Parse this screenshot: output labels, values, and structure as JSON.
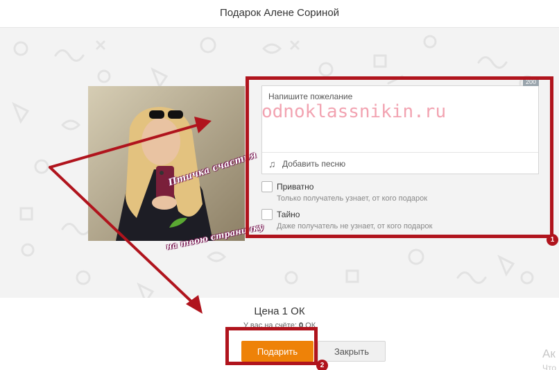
{
  "dialog": {
    "title": "Подарок Алене Сориной"
  },
  "wish": {
    "placeholder": "Напишите пожелание",
    "counter": "200",
    "add_song_label": "Добавить песню"
  },
  "watermark": "odnoklassnikin.ru",
  "sticker": {
    "line1": "Птичка счастья",
    "line2": "на твою страничку"
  },
  "options": [
    {
      "label": "Приватно",
      "hint": "Только получатель узнает, от кого подарок"
    },
    {
      "label": "Тайно",
      "hint": "Даже получатель не узнает, от кого подарок"
    }
  ],
  "price": {
    "label": "Цена 1 ОК",
    "balance_prefix": "У вас на счёте:",
    "balance_value": "0",
    "balance_unit": "ОК"
  },
  "buttons": {
    "gift": "Подарить",
    "close": "Закрыть"
  },
  "annotations": {
    "badge1": "1",
    "badge2": "2",
    "color": "#b0141d"
  },
  "os_watermark": {
    "line1": "Ак",
    "line2": "Что"
  },
  "colors": {
    "accent": "#ee8208",
    "pattern_bg": "#f3f3f3"
  }
}
